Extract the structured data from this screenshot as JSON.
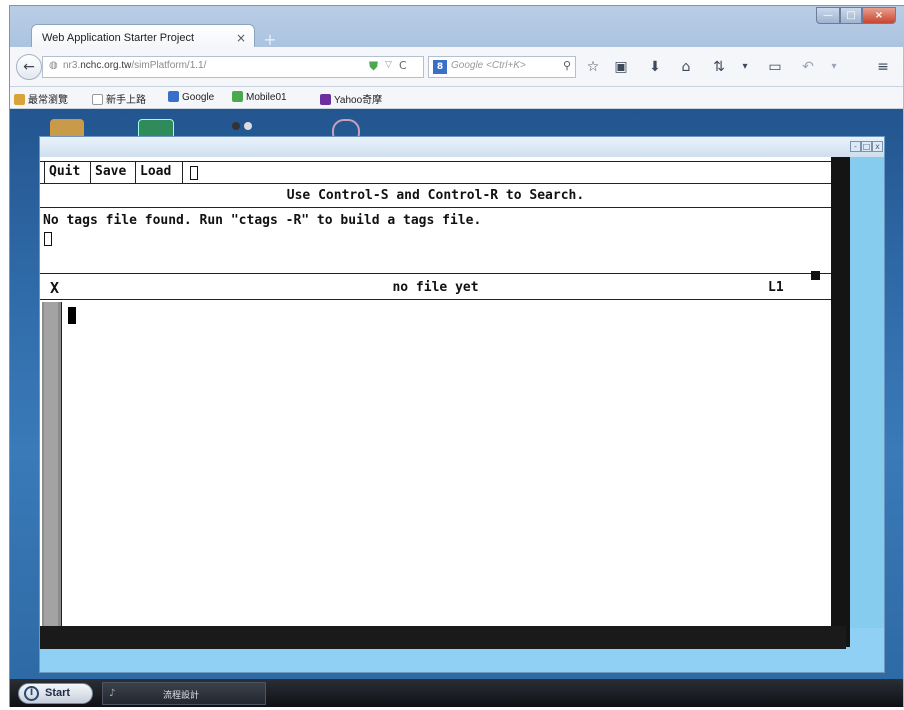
{
  "browser": {
    "tab_title": "Web Application Starter Project",
    "tab_close": "×",
    "new_tab": "+",
    "window_controls": {
      "minimize": "—",
      "maximize": "□",
      "close": "×"
    },
    "url_host_dim": "nr3.",
    "url_host": "nchc.org.tw",
    "url_path": "/simPlatform/1.1/",
    "search_engine_letter": "8",
    "search_placeholder": "Google <Ctrl+K>",
    "icons": [
      "back-icon",
      "shield-icon",
      "reload-icon",
      "search-icon",
      "star-icon",
      "bookmarks-menu-icon",
      "download-icon",
      "home-icon",
      "sync-icon",
      "chat-icon",
      "undo-icon",
      "menu-icon"
    ],
    "bookmarks": [
      {
        "label": "最常瀏覽",
        "color": "#d8a43a"
      },
      {
        "label": "新手上路",
        "color": "#ffffff"
      },
      {
        "label": "Google",
        "color": "#3a6fc8"
      },
      {
        "label": "Mobile01",
        "color": "#4ca84c"
      },
      {
        "label": "Yahoo奇摩",
        "color": "#6b2fa0"
      }
    ]
  },
  "inner_window": {
    "controls": {
      "minimize": "-",
      "maximize": "□",
      "close": "x"
    }
  },
  "editor": {
    "menu": {
      "quit": "Quit",
      "save": "Save",
      "load": "Load"
    },
    "search_hint": "Use Control-S and Control-R to Search.",
    "message": "No tags file found. Run \"ctags -R\" to build a tags file.",
    "status": {
      "close_glyph": "X",
      "file": "no file yet",
      "line": "L1"
    }
  },
  "taskbar": {
    "start_label": "Start",
    "task_label": "流程設計"
  }
}
